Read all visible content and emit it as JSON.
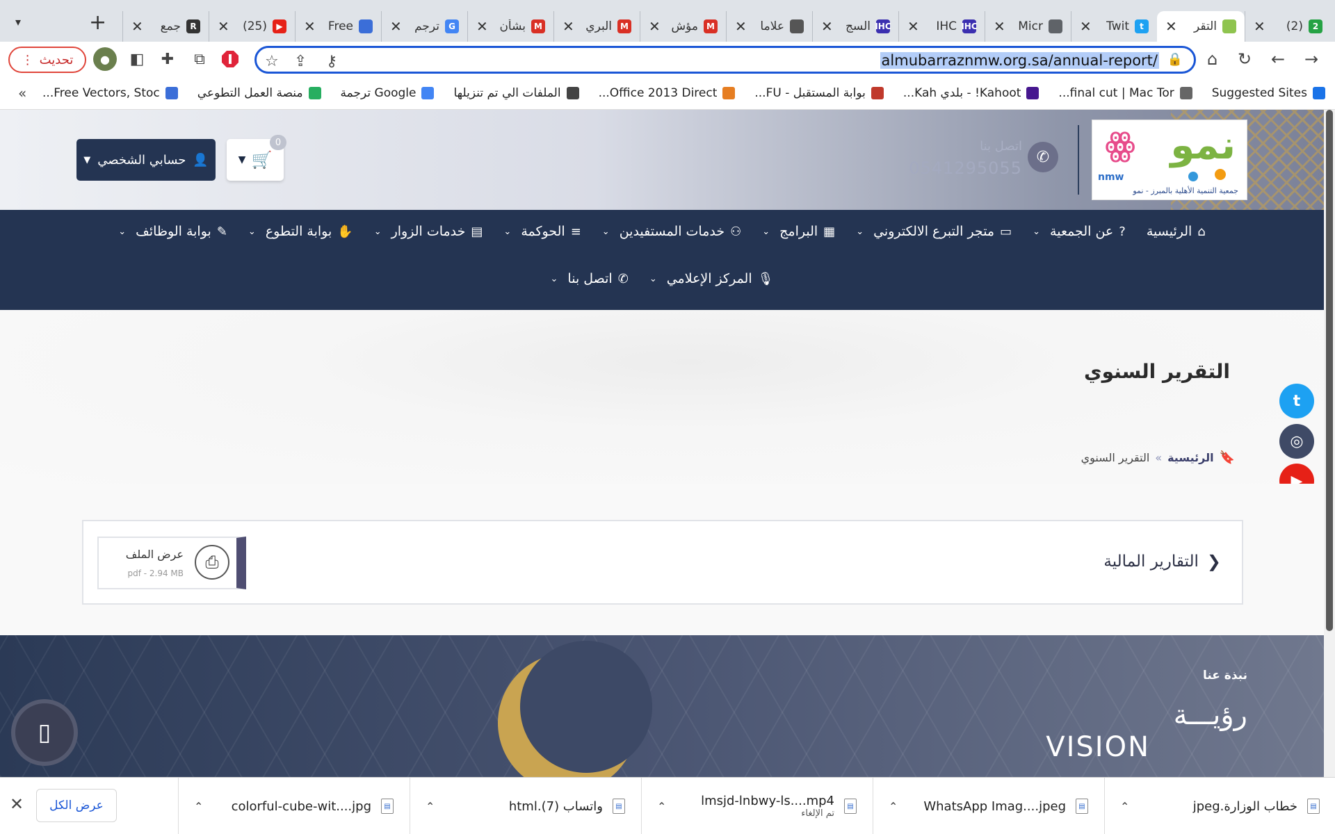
{
  "browser": {
    "tabs": [
      {
        "title": "(2)",
        "color": "#25a244",
        "fav": "2",
        "active": false
      },
      {
        "title": "التقر",
        "color": "#8fc44f",
        "fav": "",
        "active": true
      },
      {
        "title": "Twit",
        "color": "#1da1f2",
        "fav": "t",
        "active": false
      },
      {
        "title": "Micr",
        "color": "#5f6368",
        "fav": "",
        "active": false
      },
      {
        "title": "IHC",
        "color": "#3b2fb0",
        "fav": "IHC",
        "active": false
      },
      {
        "title": "السج",
        "color": "#3b2fb0",
        "fav": "IHC",
        "active": false
      },
      {
        "title": "علاما",
        "color": "#555",
        "fav": "",
        "active": false
      },
      {
        "title": "مؤش",
        "color": "#d93025",
        "fav": "M",
        "active": false
      },
      {
        "title": "البري",
        "color": "#d93025",
        "fav": "M",
        "active": false
      },
      {
        "title": "بشأن",
        "color": "#d93025",
        "fav": "M",
        "active": false
      },
      {
        "title": "ترجم",
        "color": "#4285f4",
        "fav": "G",
        "active": false
      },
      {
        "title": "Free",
        "color": "#3b6ed8",
        "fav": "",
        "active": false
      },
      {
        "title": "(25)",
        "color": "#e62117",
        "fav": "▶",
        "active": false
      },
      {
        "title": "جمع",
        "color": "#333",
        "fav": "R",
        "active": false
      }
    ],
    "new_tab_label": "+",
    "update_label": "تحديث",
    "url": "almubarraznmw.org.sa/annual-report/"
  },
  "bookmarks": [
    {
      "label": "Suggested Sites",
      "color": "#1a73e8"
    },
    {
      "label": "final cut | Mac Tor...",
      "color": "#666"
    },
    {
      "label": "Kahoot! - بلدي Kah...",
      "color": "#46178f"
    },
    {
      "label": "بوابة المستقبل - FU...",
      "color": "#c0392b"
    },
    {
      "label": "Office 2013 Direct...",
      "color": "#e67e22"
    },
    {
      "label": "الملفات الي تم تنزيلها",
      "color": "#444"
    },
    {
      "label": "Google ترجمة",
      "color": "#4285f4"
    },
    {
      "label": "منصة العمل التطوعي",
      "color": "#27ae60"
    },
    {
      "label": "Free Vectors, Stoc...",
      "color": "#3b6ed8"
    }
  ],
  "bookmarks_more": "»",
  "site": {
    "logo_main": "نمو",
    "logo_sub": "جمعية التنمية الأهلية بالمبرز - نمو",
    "logo_en": "nmw",
    "contact_label": "اتصل بنا",
    "contact_number": "0541295055",
    "cart_count": "0",
    "account_label": "حسابي الشخصي",
    "nav_row1": [
      {
        "label": "الرئيسية",
        "icon": "⌂"
      },
      {
        "label": "عن الجمعية",
        "icon": "?"
      },
      {
        "label": "متجر التبرع الالكتروني",
        "icon": "▭"
      },
      {
        "label": "البرامج",
        "icon": "▦"
      },
      {
        "label": "خدمات المستفيدين",
        "icon": "⚇"
      },
      {
        "label": "الحوكمة",
        "icon": "≡"
      },
      {
        "label": "خدمات الزوار",
        "icon": "▤"
      },
      {
        "label": "بوابة التطوع",
        "icon": "✋"
      },
      {
        "label": "بوابة الوظائف",
        "icon": "✎"
      }
    ],
    "nav_row2": [
      {
        "label": "المركز الإعلامي",
        "icon": "🎙"
      },
      {
        "label": "اتصل بنا",
        "icon": "✆"
      }
    ],
    "page_title": "التقرير السنوي",
    "breadcrumb": {
      "home": "الرئيسية",
      "separator": "»",
      "current": "التقرير السنوي"
    },
    "section_title": "التقارير المالية",
    "file": {
      "label": "عرض الملف",
      "meta": "pdf - 2.94 MB"
    },
    "footer_about": "نبذة عنا",
    "vision_en": "VISION",
    "vision_ar": "رؤيـــة",
    "social": [
      {
        "name": "twitter",
        "color": "#1da1f2",
        "glyph": "t"
      },
      {
        "name": "instagram",
        "color": "#3f4a66",
        "glyph": "◎"
      },
      {
        "name": "youtube",
        "color": "#e62117",
        "glyph": "▶"
      }
    ]
  },
  "downloads": {
    "items": [
      {
        "name": "خطاب الوزارة.jpeg",
        "sub": ""
      },
      {
        "name": "WhatsApp Imag....jpeg",
        "sub": ""
      },
      {
        "name": "lmsjd-lnbwy-ls....mp4",
        "sub": "تم الإلغاء"
      },
      {
        "name": "واتساب (7).html",
        "sub": ""
      },
      {
        "name": "colorful-cube-wit....jpg",
        "sub": ""
      }
    ],
    "show_all": "عرض الكل"
  }
}
